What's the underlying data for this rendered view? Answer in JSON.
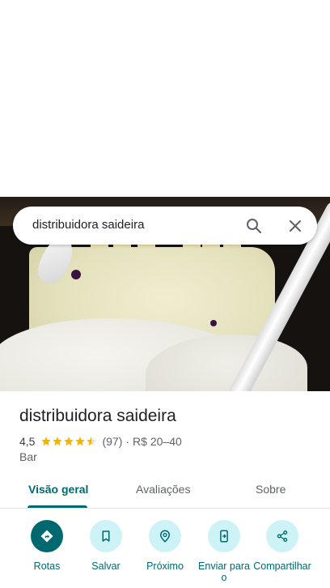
{
  "search": {
    "query": "distribuidora saideira"
  },
  "place": {
    "name": "distribuidora saideira",
    "rating": "4,5",
    "review_count": "(97)",
    "separator": "·",
    "price_range": "R$ 20–40",
    "category": "Bar",
    "stars_rating": 4.5
  },
  "tabs": [
    {
      "label": "Visão geral"
    },
    {
      "label": "Avaliações"
    },
    {
      "label": "Sobre"
    }
  ],
  "actions": [
    {
      "label": "Rotas",
      "icon": "directions-icon"
    },
    {
      "label": "Salvar",
      "icon": "bookmark-icon"
    },
    {
      "label": "Próximo",
      "icon": "nearby-icon"
    },
    {
      "label": "Enviar para o",
      "icon": "send-to-phone-icon"
    },
    {
      "label": "Compartilhar",
      "icon": "share-icon"
    }
  ],
  "colors": {
    "accent": "#00696f",
    "action_bg": "#cdf3f6",
    "star": "#f4b400"
  }
}
